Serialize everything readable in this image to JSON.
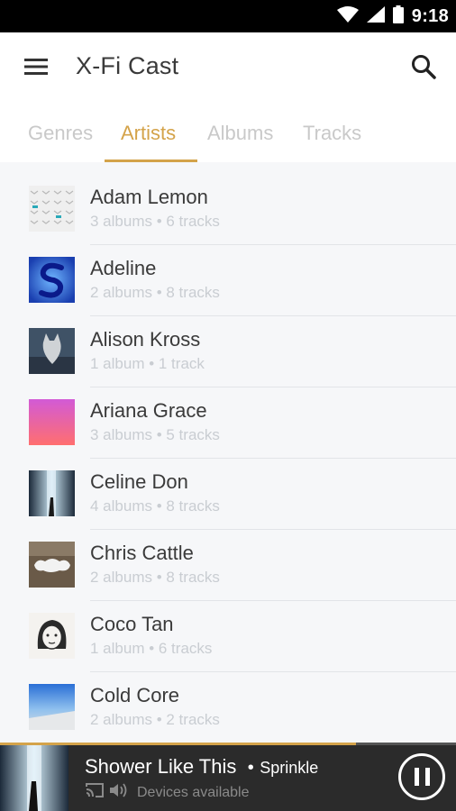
{
  "status_bar": {
    "time": "9:18",
    "icons": [
      "wifi-icon",
      "signal-icon",
      "battery-icon"
    ]
  },
  "app_bar": {
    "title": "X-Fi Cast",
    "menu_icon": "hamburger-menu-icon",
    "search_icon": "search-icon"
  },
  "tabs": [
    {
      "label": "Genres",
      "active": false
    },
    {
      "label": "Artists",
      "active": true
    },
    {
      "label": "Albums",
      "active": false
    },
    {
      "label": "Tracks",
      "active": false
    }
  ],
  "artists": [
    {
      "name": "Adam Lemon",
      "meta": "3 albums • 6 tracks"
    },
    {
      "name": "Adeline",
      "meta": "2 albums • 8 tracks"
    },
    {
      "name": "Alison Kross",
      "meta": "1 album • 1 track"
    },
    {
      "name": "Ariana Grace",
      "meta": "3 albums • 5 tracks"
    },
    {
      "name": "Celine Don",
      "meta": "4 albums • 8 tracks"
    },
    {
      "name": "Chris Cattle",
      "meta": "2 albums • 8 tracks"
    },
    {
      "name": "Coco Tan",
      "meta": "1 album • 6 tracks"
    },
    {
      "name": "Cold Core",
      "meta": "2 albums • 2 tracks"
    }
  ],
  "player": {
    "title": "Shower Like This",
    "separator": "•",
    "artist": "Sprinkle",
    "devices_label": "Devices available",
    "progress": 0.78,
    "cast_icon": "cast-icon",
    "speaker_icon": "speaker-waves-icon",
    "pause_icon": "pause-icon"
  },
  "colors": {
    "accent": "#d4a34a",
    "status_bar": "#000000",
    "player_bg": "#2b2b2b",
    "list_bg": "#f6f7f9"
  }
}
